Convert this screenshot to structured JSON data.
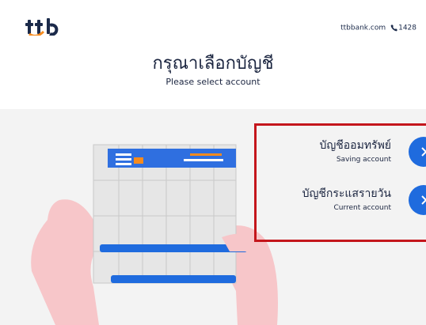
{
  "header": {
    "logo_text": "ttb",
    "site": "ttbbank.com",
    "phone": "1428"
  },
  "title": {
    "thai": "กรุณาเลือกบัญชี",
    "english": "Please select account"
  },
  "accounts": [
    {
      "thai": "บัญชีออมทรัพย์",
      "english": "Saving account"
    },
    {
      "thai": "บัญชีกระแสรายวัน",
      "english": "Current account"
    }
  ],
  "colors": {
    "brand_navy": "#1b2540",
    "brand_blue": "#1f6bde",
    "brand_orange": "#f68b1e",
    "highlight_red": "#c4161c",
    "background": "#f3f3f3"
  },
  "icons": [
    "ttb-logo",
    "phone-icon",
    "chevron-right-icon",
    "chevron-right-icon"
  ]
}
